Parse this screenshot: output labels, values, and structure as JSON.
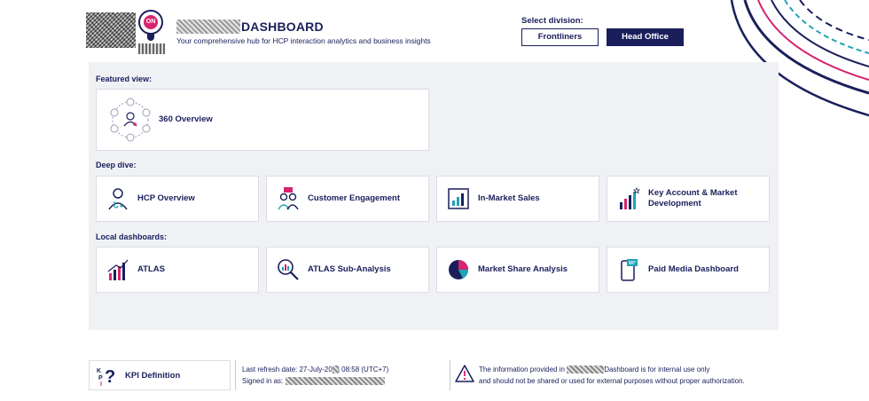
{
  "header": {
    "title": "DASHBOARD",
    "subtitle": "Your comprehensive hub for HCP interaction analytics and business insights",
    "logo_badge": "ON"
  },
  "division": {
    "label": "Select division:",
    "options": [
      "Frontliners",
      "Head Office"
    ],
    "selected": "Head Office"
  },
  "featured": {
    "label": "Featured view:",
    "card": {
      "label": "360 Overview",
      "icon": "network-overview-icon"
    }
  },
  "deep_dive": {
    "label": "Deep dive:",
    "cards": [
      {
        "label": "HCP Overview",
        "icon": "doctor-icon"
      },
      {
        "label": "Customer Engagement",
        "icon": "people-chat-icon"
      },
      {
        "label": "In-Market Sales",
        "icon": "bar-chart-icon"
      },
      {
        "label": "Key Account & Market Development",
        "icon": "growth-chart-icon"
      }
    ]
  },
  "local": {
    "label": "Local dashboards:",
    "cards": [
      {
        "label": "ATLAS",
        "icon": "trend-chart-icon"
      },
      {
        "label": "ATLAS Sub-Analysis",
        "icon": "magnifier-chart-icon"
      },
      {
        "label": "Market Share Analysis",
        "icon": "pie-chart-icon"
      },
      {
        "label": "Paid Media Dashboard",
        "icon": "phone-media-icon"
      }
    ]
  },
  "footer": {
    "kpi_label": "KPI Definition",
    "refresh_prefix": "Last refresh date: 27-July-20",
    "refresh_suffix": "| 08:58 (UTC+7)",
    "signed_in": "Signed in as:",
    "notice_prefix": "The information provided in",
    "notice_line1_suffix": "Dashboard is for internal use only",
    "notice_line2": "and should not be shared or used for external purposes without proper authorization."
  },
  "colors": {
    "navy": "#1a1f5c",
    "magenta": "#d6246e",
    "teal": "#1fa3b5",
    "panel": "#f0f1f5"
  }
}
